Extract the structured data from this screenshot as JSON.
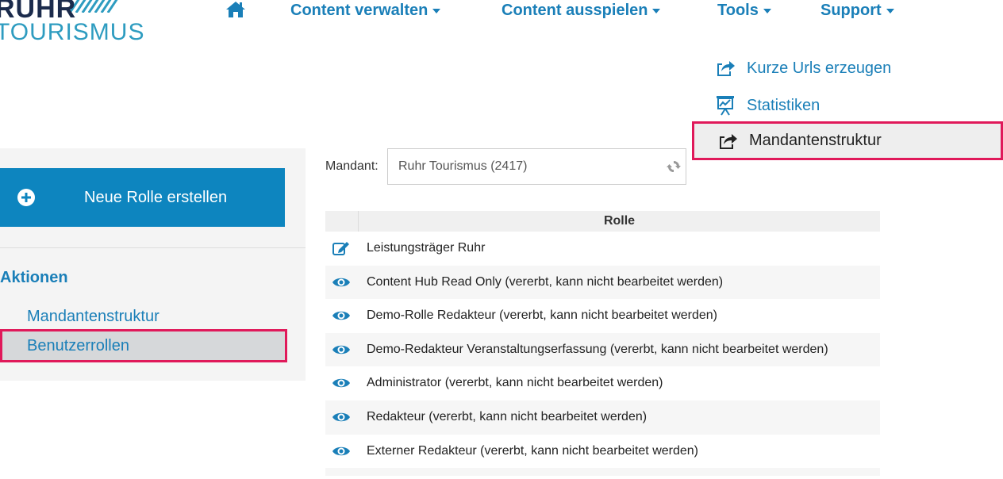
{
  "logo": {
    "line1": "RUHR",
    "line2": "TOURISMUS"
  },
  "nav": {
    "home_icon": "home-icon",
    "items": [
      {
        "label": "Content verwalten"
      },
      {
        "label": "Content ausspielen"
      },
      {
        "label": "Tools"
      },
      {
        "label": "Support"
      }
    ]
  },
  "tools_menu": {
    "items": [
      {
        "label": "Kurze Urls erzeugen",
        "icon": "share-icon"
      },
      {
        "label": "Statistiken",
        "icon": "chart-board-icon"
      },
      {
        "label": "Mandantenstruktur",
        "icon": "share-icon",
        "active": true
      }
    ]
  },
  "sidebar": {
    "new_role_label": "Neue Rolle erstellen",
    "section_title": "Aktionen",
    "links": [
      {
        "label": "Mandantenstruktur"
      },
      {
        "label": "Benutzerrollen",
        "active": true
      }
    ]
  },
  "mandant": {
    "label": "Mandant:",
    "value": "Ruhr Tourismus (2417)"
  },
  "table": {
    "header": "Rolle",
    "rows": [
      {
        "icon": "edit-icon",
        "name": "Leistungsträger Ruhr"
      },
      {
        "icon": "eye-icon",
        "name": "Content Hub Read Only (vererbt, kann nicht bearbeitet werden)"
      },
      {
        "icon": "eye-icon",
        "name": "Demo-Rolle Redakteur (vererbt, kann nicht bearbeitet werden)"
      },
      {
        "icon": "eye-icon",
        "name": "Demo-Redakteur Veranstaltungserfassung (vererbt, kann nicht bearbeitet werden)"
      },
      {
        "icon": "eye-icon",
        "name": "Administrator (vererbt, kann nicht bearbeitet werden)"
      },
      {
        "icon": "eye-icon",
        "name": "Redakteur (vererbt, kann nicht bearbeitet werden)"
      },
      {
        "icon": "eye-icon",
        "name": "Externer Redakteur (vererbt, kann nicht bearbeitet werden)"
      }
    ]
  },
  "colors": {
    "brand_blue": "#1a7fb8",
    "button_blue": "#0d85bf",
    "highlight": "#e0195a"
  }
}
